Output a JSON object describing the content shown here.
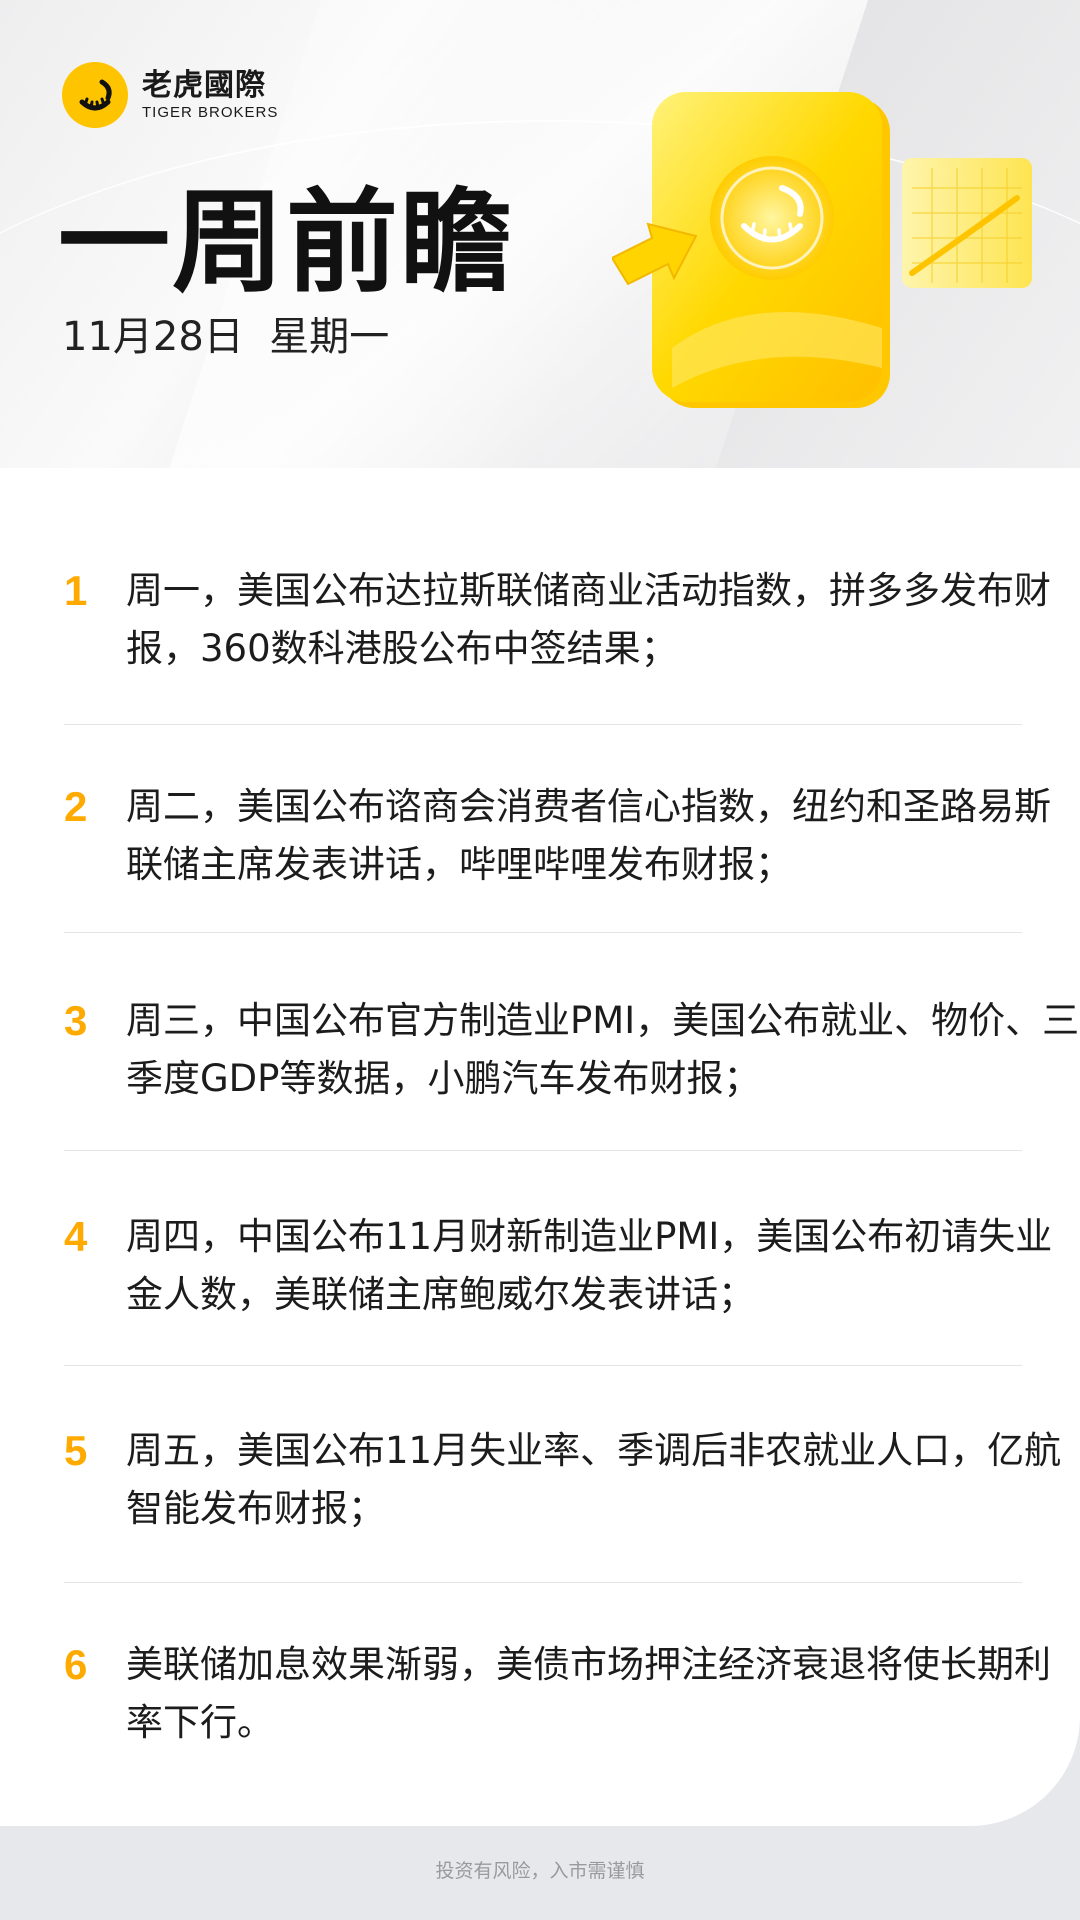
{
  "brand": {
    "name_cn": "老虎國際",
    "name_en": "TIGER BROKERS",
    "logo_icon": "tiger-brokers-logo-icon",
    "accent_color": "#ffc400"
  },
  "header": {
    "title": "一周前瞻",
    "date": "11月28日  星期一",
    "hero_icon": "gold-card-with-coin-and-arrow-illustration"
  },
  "items": [
    {
      "num": "1",
      "text": "周一，美国公布达拉斯联储商业活动指数，拼多多发布财报，360数科港股公布中签结果；"
    },
    {
      "num": "2",
      "text": "周二，美国公布谘商会消费者信心指数，纽约和圣路易斯联储主席发表讲话，哔哩哔哩发布财报；"
    },
    {
      "num": "3",
      "text": "周三，中国公布官方制造业PMI，美国公布就业、物价、三季度GDP等数据，小鹏汽车发布财报；"
    },
    {
      "num": "4",
      "text": "周四，中国公布11月财新制造业PMI，美国公布初请失业金人数，美联储主席鲍威尔发表讲话；"
    },
    {
      "num": "5",
      "text": "周五，美国公布11月失业率、季调后非农就业人口，亿航智能发布财报；"
    },
    {
      "num": "6",
      "text": "美联储加息效果渐弱，美债市场押注经济衰退将使长期利率下行。"
    }
  ],
  "footer": {
    "disclaimer": "投资有风险，入市需谨慎"
  },
  "colors": {
    "number": "#ffaa00",
    "background": "#e7e8ec"
  }
}
